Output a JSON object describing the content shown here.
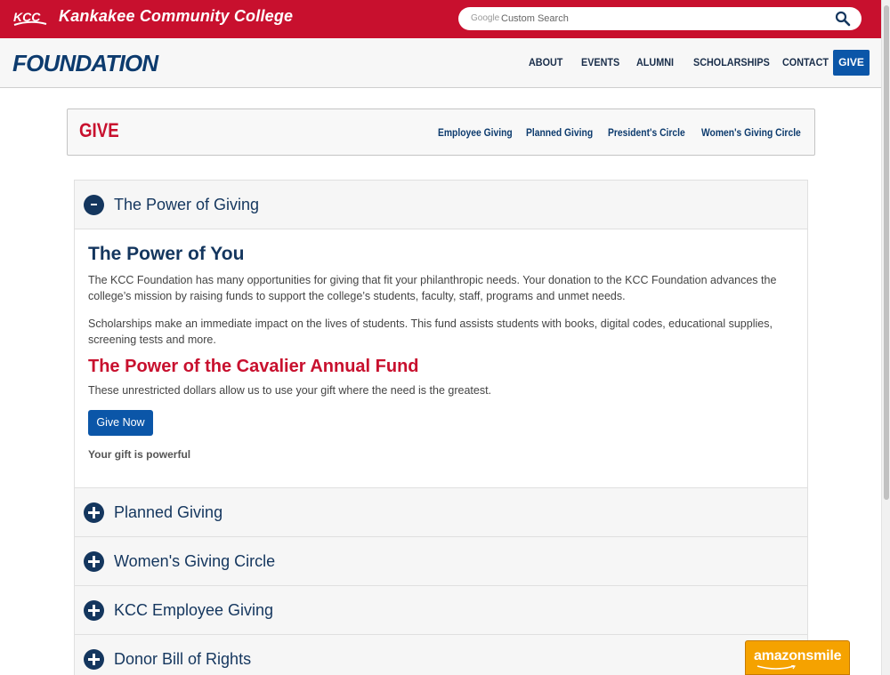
{
  "header": {
    "logo_text": "KCC",
    "college_name": "Kankakee Community College",
    "search_brand": "Google",
    "search_placeholder": "Custom Search",
    "icons": {
      "search": "search-icon",
      "logo": "kcc-logo-icon"
    },
    "colors": {
      "topbar": "#c8102e",
      "navy": "#0d3b6e",
      "button": "#0b56a8"
    }
  },
  "nav": {
    "brand": "FOUNDATION",
    "items": [
      "ABOUT",
      "EVENTS",
      "ALUMNI",
      "SCHOLARSHIPS",
      "CONTACT"
    ],
    "give_label": "GIVE"
  },
  "subnav": {
    "title": "GIVE",
    "links": [
      "Employee Giving",
      "Planned Giving",
      "President's Circle",
      "Women's Giving Circle"
    ]
  },
  "accordion": {
    "expanded": {
      "title": "The Power of Giving",
      "heading": "The Power of You",
      "paragraph1": "The KCC Foundation has many opportunities for giving that fit your philanthropic needs. Your donation to the KCC Foundation advances the college’s mission by raising funds to support the college’s students, faculty, staff, programs and unmet needs.",
      "paragraph2": "Scholarships make an immediate impact on the lives of students. This fund assists students with books, digital codes, educational supplies, screening tests and more.",
      "heading2": "The Power of the Cavalier Annual Fund",
      "paragraph3": "These unrestricted dollars allow us to use your gift where the need is the greatest.",
      "button_label": "Give Now",
      "footer_bold": "Your gift is powerful"
    },
    "collapsed": [
      "Planned Giving",
      "Women's Giving Circle",
      "KCC Employee Giving",
      "Donor Bill of Rights"
    ]
  },
  "amazon": {
    "label": "amazonsmile",
    "icon": "amazon-smile-icon"
  }
}
